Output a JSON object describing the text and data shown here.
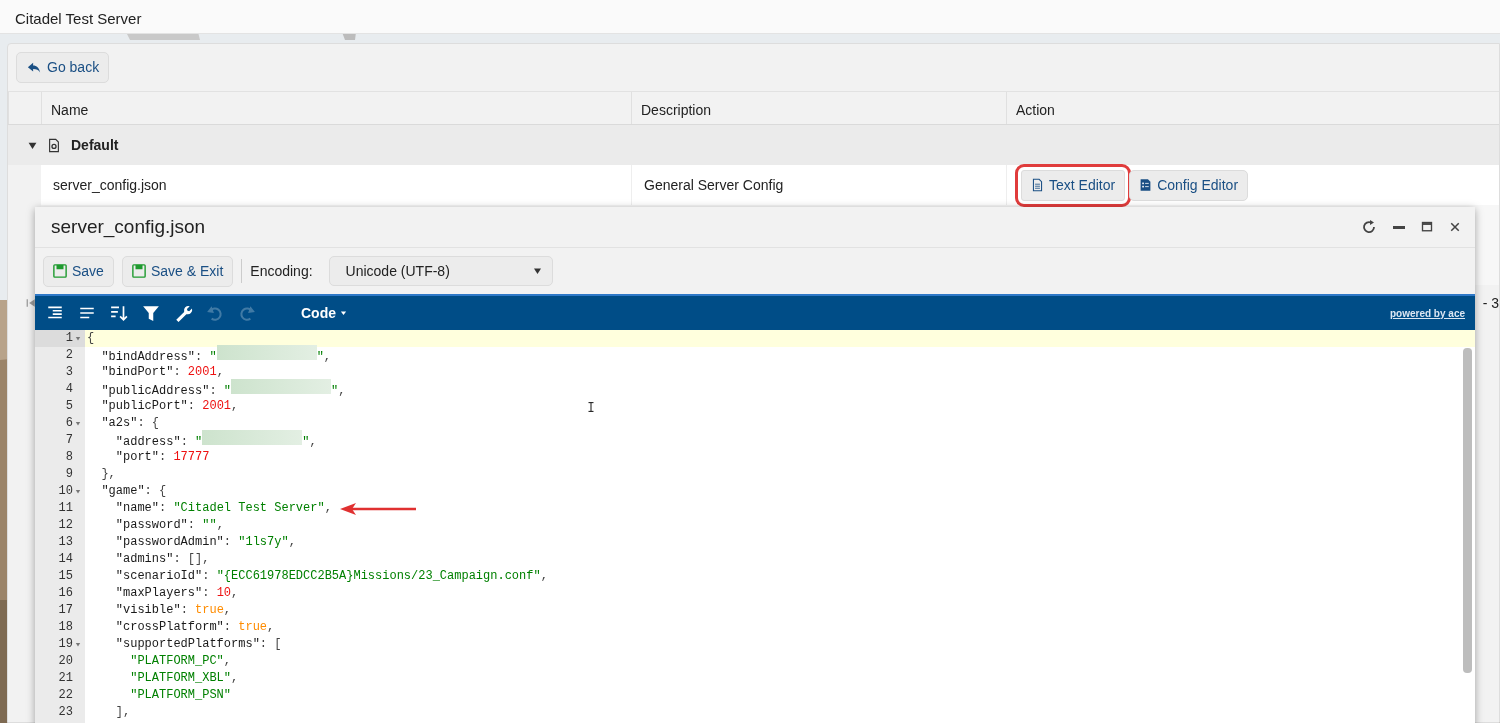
{
  "page_title": "Citadel Test Server",
  "back_button": "Go back",
  "table": {
    "columns": [
      "Name",
      "Description",
      "Action"
    ],
    "groups": [
      {
        "label": "Default",
        "expanded": true,
        "rows": [
          {
            "name": "server_config.json",
            "description": "General Server Config",
            "actions": [
              {
                "kind": "text",
                "label": "Text Editor",
                "highlighted": true
              },
              {
                "kind": "config",
                "label": "Config Editor",
                "highlighted": false
              }
            ]
          }
        ]
      }
    ]
  },
  "pager": {
    "range": "- 3"
  },
  "editor_window": {
    "title": "server_config.json",
    "toolbar": {
      "save": "Save",
      "save_exit": "Save & Exit",
      "encoding_label": "Encoding:",
      "encoding_value": "Unicode (UTF-8)"
    },
    "ace_toolbar": {
      "mode": "Code",
      "credit": "powered by ace",
      "undo_disabled": true,
      "redo_disabled": true
    },
    "lines": [
      {
        "number": "1",
        "foldable": true,
        "active": true,
        "annotated": false,
        "tokens": [
          {
            "kind": "p",
            "text": "{"
          }
        ]
      },
      {
        "number": "2",
        "foldable": false,
        "active": false,
        "annotated": false,
        "tokens": [
          {
            "kind": "k",
            "text": "  \"bindAddress\""
          },
          {
            "kind": "p",
            "text": ": "
          },
          {
            "kind": "s",
            "text": "\""
          },
          {
            "kind": "r"
          },
          {
            "kind": "s",
            "text": "\""
          },
          {
            "kind": "p",
            "text": ","
          }
        ]
      },
      {
        "number": "3",
        "foldable": false,
        "active": false,
        "annotated": false,
        "tokens": [
          {
            "kind": "k",
            "text": "  \"bindPort\""
          },
          {
            "kind": "p",
            "text": ": "
          },
          {
            "kind": "n",
            "text": "2001"
          },
          {
            "kind": "p",
            "text": ","
          }
        ]
      },
      {
        "number": "4",
        "foldable": false,
        "active": false,
        "annotated": false,
        "tokens": [
          {
            "kind": "k",
            "text": "  \"publicAddress\""
          },
          {
            "kind": "p",
            "text": ": "
          },
          {
            "kind": "s",
            "text": "\""
          },
          {
            "kind": "r"
          },
          {
            "kind": "s",
            "text": "\""
          },
          {
            "kind": "p",
            "text": ","
          }
        ]
      },
      {
        "number": "5",
        "foldable": false,
        "active": false,
        "annotated": false,
        "tokens": [
          {
            "kind": "k",
            "text": "  \"publicPort\""
          },
          {
            "kind": "p",
            "text": ": "
          },
          {
            "kind": "n",
            "text": "2001"
          },
          {
            "kind": "p",
            "text": ","
          }
        ]
      },
      {
        "number": "6",
        "foldable": true,
        "active": false,
        "annotated": false,
        "tokens": [
          {
            "kind": "k",
            "text": "  \"a2s\""
          },
          {
            "kind": "p",
            "text": ": {"
          }
        ]
      },
      {
        "number": "7",
        "foldable": false,
        "active": false,
        "annotated": false,
        "tokens": [
          {
            "kind": "k",
            "text": "    \"address\""
          },
          {
            "kind": "p",
            "text": ": "
          },
          {
            "kind": "s",
            "text": "\""
          },
          {
            "kind": "r"
          },
          {
            "kind": "s",
            "text": "\""
          },
          {
            "kind": "p",
            "text": ","
          }
        ]
      },
      {
        "number": "8",
        "foldable": false,
        "active": false,
        "annotated": false,
        "tokens": [
          {
            "kind": "k",
            "text": "    \"port\""
          },
          {
            "kind": "p",
            "text": ": "
          },
          {
            "kind": "n",
            "text": "17777"
          }
        ]
      },
      {
        "number": "9",
        "foldable": false,
        "active": false,
        "annotated": false,
        "tokens": [
          {
            "kind": "p",
            "text": "  },"
          }
        ]
      },
      {
        "number": "10",
        "foldable": true,
        "active": false,
        "annotated": false,
        "tokens": [
          {
            "kind": "k",
            "text": "  \"game\""
          },
          {
            "kind": "p",
            "text": ": {"
          }
        ]
      },
      {
        "number": "11",
        "foldable": false,
        "active": false,
        "annotated": true,
        "tokens": [
          {
            "kind": "k",
            "text": "    \"name\""
          },
          {
            "kind": "p",
            "text": ": "
          },
          {
            "kind": "s",
            "text": "\"Citadel Test Server\""
          },
          {
            "kind": "p",
            "text": ","
          }
        ]
      },
      {
        "number": "12",
        "foldable": false,
        "active": false,
        "annotated": false,
        "tokens": [
          {
            "kind": "k",
            "text": "    \"password\""
          },
          {
            "kind": "p",
            "text": ": "
          },
          {
            "kind": "s",
            "text": "\"\""
          },
          {
            "kind": "p",
            "text": ","
          }
        ]
      },
      {
        "number": "13",
        "foldable": false,
        "active": false,
        "annotated": false,
        "tokens": [
          {
            "kind": "k",
            "text": "    \"passwordAdmin\""
          },
          {
            "kind": "p",
            "text": ": "
          },
          {
            "kind": "s",
            "text": "\"1ls7y\""
          },
          {
            "kind": "p",
            "text": ","
          }
        ]
      },
      {
        "number": "14",
        "foldable": false,
        "active": false,
        "annotated": false,
        "tokens": [
          {
            "kind": "k",
            "text": "    \"admins\""
          },
          {
            "kind": "p",
            "text": ": [],"
          }
        ]
      },
      {
        "number": "15",
        "foldable": false,
        "active": false,
        "annotated": false,
        "tokens": [
          {
            "kind": "k",
            "text": "    \"scenarioId\""
          },
          {
            "kind": "p",
            "text": ": "
          },
          {
            "kind": "s",
            "text": "\"{ECC61978EDCC2B5A}Missions/23_Campaign.conf\""
          },
          {
            "kind": "p",
            "text": ","
          }
        ]
      },
      {
        "number": "16",
        "foldable": false,
        "active": false,
        "annotated": false,
        "tokens": [
          {
            "kind": "k",
            "text": "    \"maxPlayers\""
          },
          {
            "kind": "p",
            "text": ": "
          },
          {
            "kind": "n",
            "text": "10"
          },
          {
            "kind": "p",
            "text": ","
          }
        ]
      },
      {
        "number": "17",
        "foldable": false,
        "active": false,
        "annotated": false,
        "tokens": [
          {
            "kind": "k",
            "text": "    \"visible\""
          },
          {
            "kind": "p",
            "text": ": "
          },
          {
            "kind": "b",
            "text": "true"
          },
          {
            "kind": "p",
            "text": ","
          }
        ]
      },
      {
        "number": "18",
        "foldable": false,
        "active": false,
        "annotated": false,
        "tokens": [
          {
            "kind": "k",
            "text": "    \"crossPlatform\""
          },
          {
            "kind": "p",
            "text": ": "
          },
          {
            "kind": "b",
            "text": "true"
          },
          {
            "kind": "p",
            "text": ","
          }
        ]
      },
      {
        "number": "19",
        "foldable": true,
        "active": false,
        "annotated": false,
        "tokens": [
          {
            "kind": "k",
            "text": "    \"supportedPlatforms\""
          },
          {
            "kind": "p",
            "text": ": ["
          }
        ]
      },
      {
        "number": "20",
        "foldable": false,
        "active": false,
        "annotated": false,
        "tokens": [
          {
            "kind": "s",
            "text": "      \"PLATFORM_PC\""
          },
          {
            "kind": "p",
            "text": ","
          }
        ]
      },
      {
        "number": "21",
        "foldable": false,
        "active": false,
        "annotated": false,
        "tokens": [
          {
            "kind": "s",
            "text": "      \"PLATFORM_XBL\""
          },
          {
            "kind": "p",
            "text": ","
          }
        ]
      },
      {
        "number": "22",
        "foldable": false,
        "active": false,
        "annotated": false,
        "tokens": [
          {
            "kind": "s",
            "text": "      \"PLATFORM_PSN\""
          }
        ]
      },
      {
        "number": "23",
        "foldable": false,
        "active": false,
        "annotated": false,
        "tokens": [
          {
            "kind": "p",
            "text": "    ],"
          }
        ]
      }
    ]
  }
}
